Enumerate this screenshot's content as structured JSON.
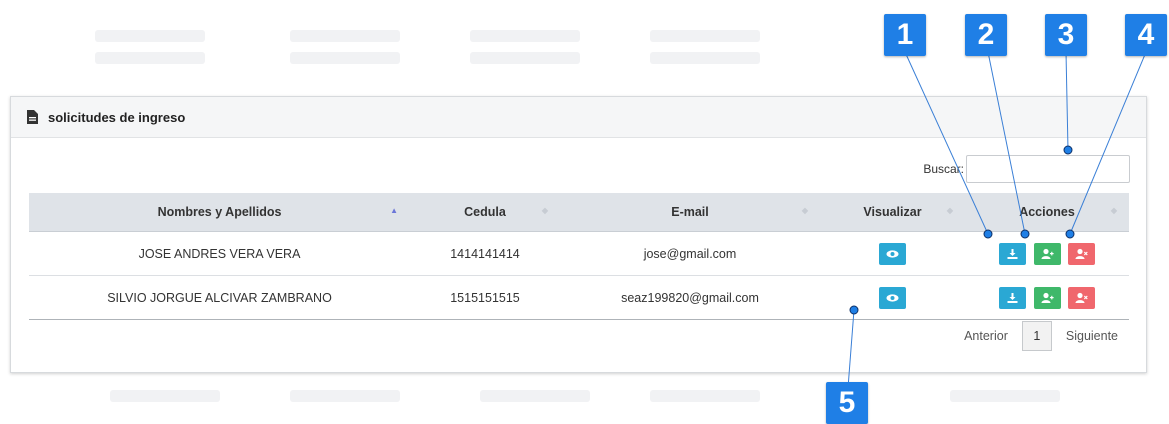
{
  "panel": {
    "title": "solicitudes de ingreso",
    "search_label": "Buscar:",
    "search_value": ""
  },
  "table": {
    "headers": [
      "Nombres y Apellidos",
      "Cedula",
      "E-mail",
      "Visualizar",
      "Acciones"
    ],
    "rows": [
      {
        "name": "JOSE ANDRES VERA VERA",
        "cedula": "1414141414",
        "email": "jose@gmail.com"
      },
      {
        "name": "SILVIO JORGUE ALCIVAR ZAMBRANO",
        "cedula": "1515151515",
        "email": "seaz199820@gmail.com"
      }
    ]
  },
  "pager": {
    "prev": "Anterior",
    "current": "1",
    "next": "Siguiente"
  },
  "callouts": [
    "1",
    "2",
    "3",
    "4",
    "5"
  ],
  "colors": {
    "info": "#2aa8d4",
    "success": "#3fb86a",
    "danger": "#f0676d",
    "callout": "#1f7fe6"
  },
  "icons": {
    "header": "document-icon",
    "view": "eye-icon",
    "download": "download-icon",
    "accept": "user-add-icon",
    "reject": "user-remove-icon"
  }
}
